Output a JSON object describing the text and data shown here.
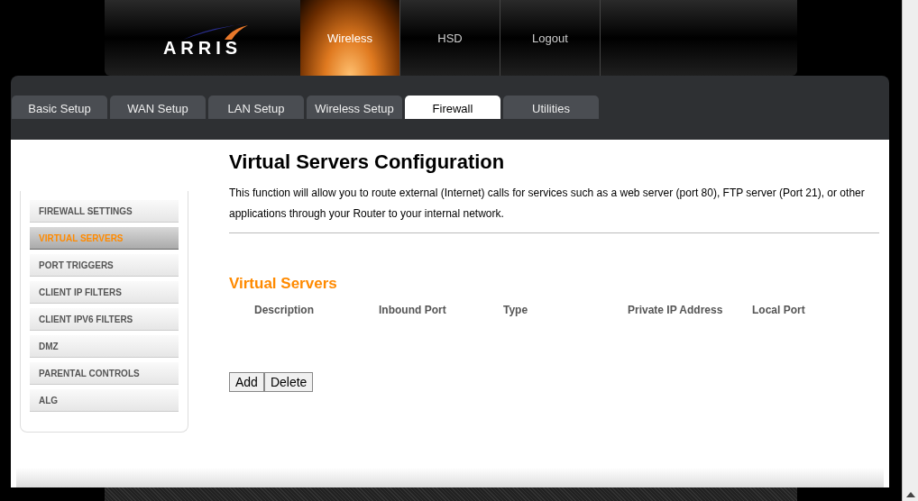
{
  "header": {
    "logo": "ARRIS",
    "nav": [
      {
        "label": "Wireless",
        "selected": true
      },
      {
        "label": "HSD",
        "selected": false
      },
      {
        "label": "Logout",
        "selected": false
      }
    ]
  },
  "tabs": [
    {
      "label": "Basic Setup",
      "selected": false
    },
    {
      "label": "WAN Setup",
      "selected": false
    },
    {
      "label": "LAN Setup",
      "selected": false
    },
    {
      "label": "Wireless Setup",
      "selected": false
    },
    {
      "label": "Firewall",
      "selected": true
    },
    {
      "label": "Utilities",
      "selected": false
    }
  ],
  "sidebar": {
    "items": [
      {
        "label": "FIREWALL SETTINGS",
        "selected": false
      },
      {
        "label": "VIRTUAL SERVERS",
        "selected": true
      },
      {
        "label": "PORT TRIGGERS",
        "selected": false
      },
      {
        "label": "CLIENT IP FILTERS",
        "selected": false
      },
      {
        "label": "CLIENT IPV6 FILTERS",
        "selected": false
      },
      {
        "label": "DMZ",
        "selected": false
      },
      {
        "label": "PARENTAL CONTROLS",
        "selected": false
      },
      {
        "label": "ALG",
        "selected": false
      }
    ]
  },
  "content": {
    "title": "Virtual Servers Configuration",
    "description": "This function will allow you to route external (Internet) calls for services such as a web server (port 80), FTP server (Port 21), or other applications through your Router to your internal network.",
    "section_title": "Virtual Servers",
    "table": {
      "columns": [
        "Description",
        "Inbound Port",
        "Type",
        "Private IP Address",
        "Local Port"
      ]
    },
    "buttons": [
      "Add",
      "Delete"
    ]
  }
}
